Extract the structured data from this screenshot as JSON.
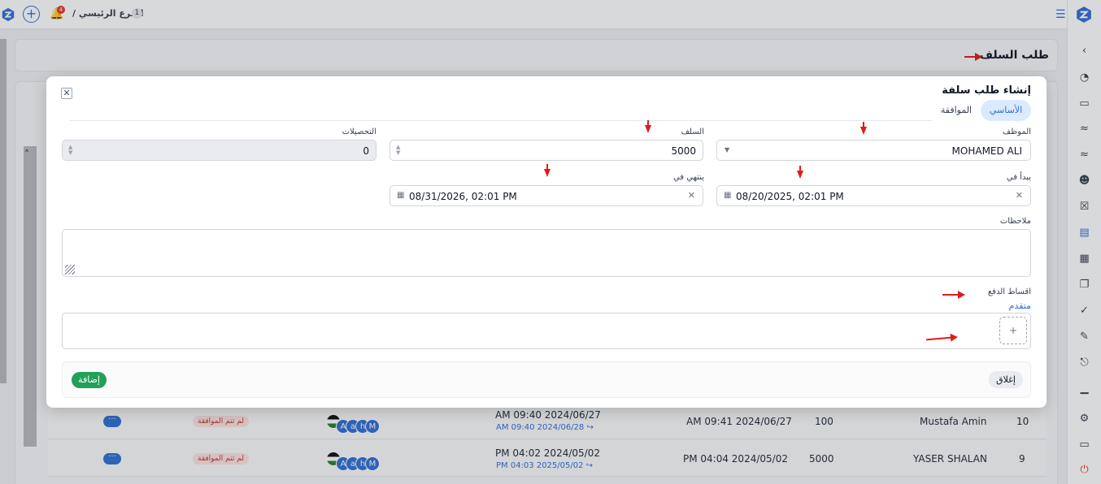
{
  "topbar": {
    "branch_label": "الفرع الرئيسي /",
    "branch_number": "1",
    "notification_count": "4"
  },
  "page": {
    "title": "طلب السلف"
  },
  "background_rows": [
    {
      "index": "10",
      "employee": "Mustafa Amin",
      "amount": "100",
      "created": "AM 09:41 2024/06/27",
      "period_start": "AM 09:40 2024/06/27",
      "period_end": "AM 09:40 2024/06/28 ↪",
      "avatars": [
        "A",
        "a",
        "h",
        "M"
      ],
      "status": "لم تتم الموافقة",
      "more_label": "···"
    },
    {
      "index": "9",
      "employee": "YASER SHALAN",
      "amount": "5000",
      "created": "PM 04:04 2024/05/02",
      "period_start": "PM 04:02 2024/05/02",
      "period_end": "PM 04:03 2025/05/02 ↪",
      "avatars": [
        "A",
        "a",
        "h",
        "M"
      ],
      "status": "لم تتم الموافقة",
      "more_label": "···"
    }
  ],
  "modal": {
    "title": "إنشاء طلب سلفة",
    "tabs": [
      {
        "label": "الأساسي",
        "active": true
      },
      {
        "label": "الموافقة",
        "active": false
      }
    ],
    "fields": {
      "employee": {
        "label": "الموظف",
        "value": "MOHAMED ALI"
      },
      "advance": {
        "label": "السلف",
        "value": "5000"
      },
      "collections": {
        "label": "التحصيلات",
        "value": "0"
      },
      "starts_at": {
        "label": "يبدأ في",
        "value": "08/20/2025, 02:01 PM"
      },
      "ends_at": {
        "label": "ينتهي في",
        "value": "08/31/2026, 02:01 PM"
      },
      "notes": {
        "label": "ملاحظات",
        "value": ""
      },
      "installments": {
        "label": "اقساط الدفع",
        "advanced_link": "متقدم",
        "add_label": "+"
      }
    },
    "buttons": {
      "submit": "إضافة",
      "close": "إغلاق"
    }
  },
  "colors": {
    "accent": "#2f6fd6",
    "success": "#22a05a",
    "annotation": "#e01b1b",
    "status_bg": "#fde2e4"
  }
}
